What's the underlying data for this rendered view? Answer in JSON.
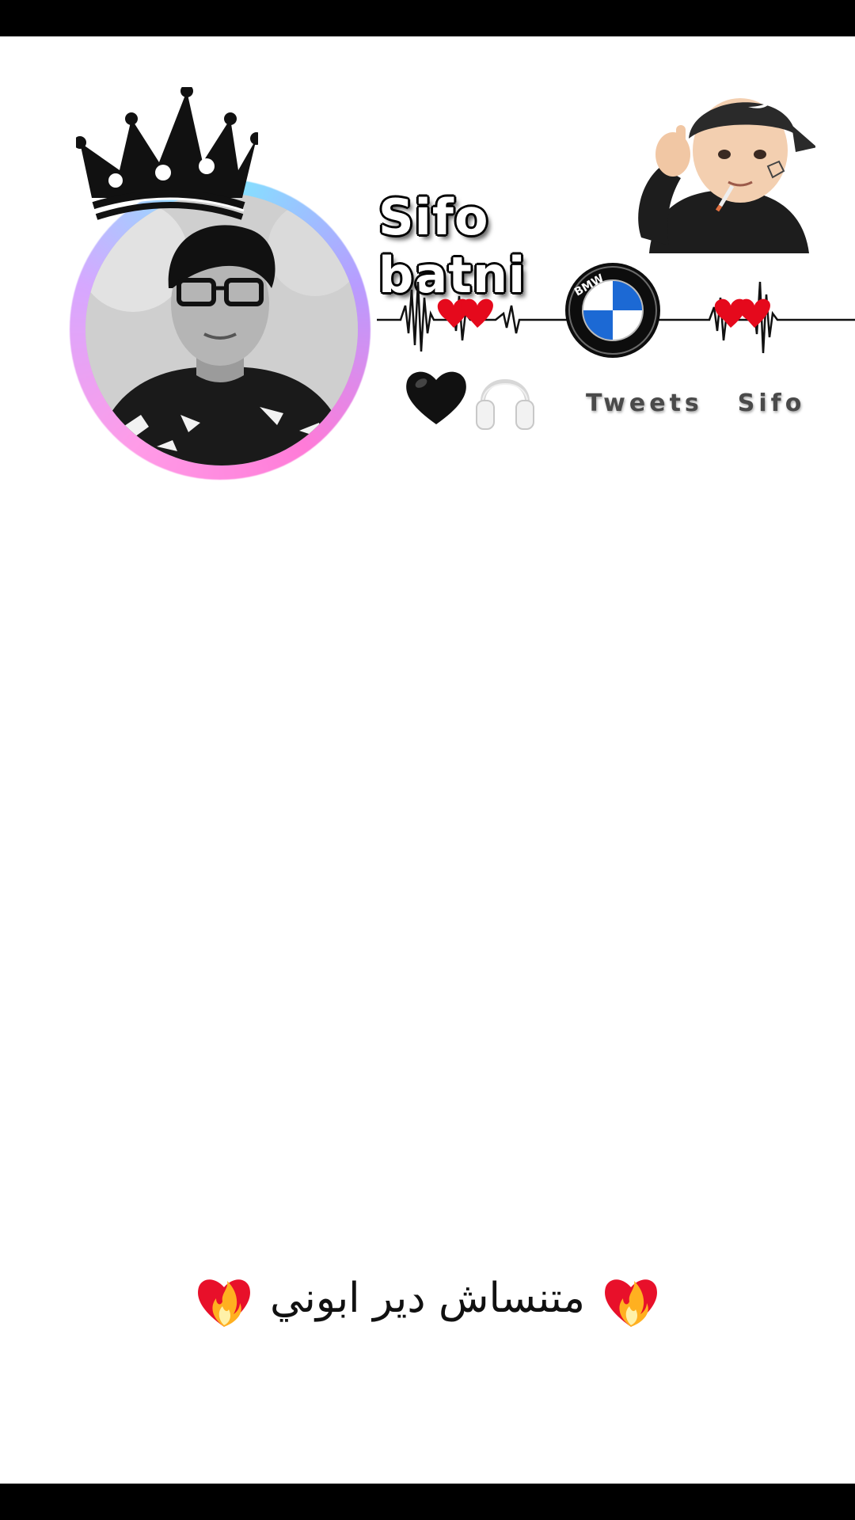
{
  "profile": {
    "name": "Sifo batni",
    "tagline_word1": "Tweets",
    "tagline_word2": "Sifo",
    "badge_text": "BMW"
  },
  "caption": {
    "text": "متنساش دير ابوني"
  },
  "icons": {
    "crown": "crown-icon",
    "memoji": "memoji-sticker",
    "heartbeat": "heartbeat-line",
    "red_hearts": "red-hearts-icon",
    "bmw": "bmw-logo",
    "black_heart": "black-heart-icon",
    "headphones": "headphones-icon",
    "heart_on_fire": "heart-on-fire-icon"
  },
  "colors": {
    "background": "#ffffff",
    "bars": "#000000",
    "ring_cyan": "#7fe8ff",
    "ring_pink": "#ff7bd8",
    "heart_red": "#e5091c",
    "bmw_blue": "#1c69d4"
  }
}
